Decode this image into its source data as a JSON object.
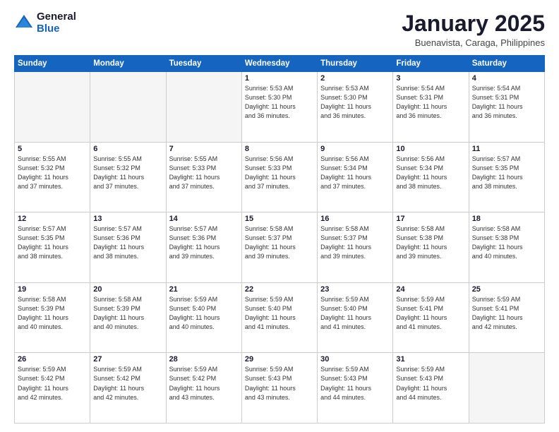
{
  "logo": {
    "general": "General",
    "blue": "Blue"
  },
  "header": {
    "month": "January 2025",
    "location": "Buenavista, Caraga, Philippines"
  },
  "weekdays": [
    "Sunday",
    "Monday",
    "Tuesday",
    "Wednesday",
    "Thursday",
    "Friday",
    "Saturday"
  ],
  "weeks": [
    [
      {
        "day": "",
        "info": ""
      },
      {
        "day": "",
        "info": ""
      },
      {
        "day": "",
        "info": ""
      },
      {
        "day": "1",
        "info": "Sunrise: 5:53 AM\nSunset: 5:30 PM\nDaylight: 11 hours\nand 36 minutes."
      },
      {
        "day": "2",
        "info": "Sunrise: 5:53 AM\nSunset: 5:30 PM\nDaylight: 11 hours\nand 36 minutes."
      },
      {
        "day": "3",
        "info": "Sunrise: 5:54 AM\nSunset: 5:31 PM\nDaylight: 11 hours\nand 36 minutes."
      },
      {
        "day": "4",
        "info": "Sunrise: 5:54 AM\nSunset: 5:31 PM\nDaylight: 11 hours\nand 36 minutes."
      }
    ],
    [
      {
        "day": "5",
        "info": "Sunrise: 5:55 AM\nSunset: 5:32 PM\nDaylight: 11 hours\nand 37 minutes."
      },
      {
        "day": "6",
        "info": "Sunrise: 5:55 AM\nSunset: 5:32 PM\nDaylight: 11 hours\nand 37 minutes."
      },
      {
        "day": "7",
        "info": "Sunrise: 5:55 AM\nSunset: 5:33 PM\nDaylight: 11 hours\nand 37 minutes."
      },
      {
        "day": "8",
        "info": "Sunrise: 5:56 AM\nSunset: 5:33 PM\nDaylight: 11 hours\nand 37 minutes."
      },
      {
        "day": "9",
        "info": "Sunrise: 5:56 AM\nSunset: 5:34 PM\nDaylight: 11 hours\nand 37 minutes."
      },
      {
        "day": "10",
        "info": "Sunrise: 5:56 AM\nSunset: 5:34 PM\nDaylight: 11 hours\nand 38 minutes."
      },
      {
        "day": "11",
        "info": "Sunrise: 5:57 AM\nSunset: 5:35 PM\nDaylight: 11 hours\nand 38 minutes."
      }
    ],
    [
      {
        "day": "12",
        "info": "Sunrise: 5:57 AM\nSunset: 5:35 PM\nDaylight: 11 hours\nand 38 minutes."
      },
      {
        "day": "13",
        "info": "Sunrise: 5:57 AM\nSunset: 5:36 PM\nDaylight: 11 hours\nand 38 minutes."
      },
      {
        "day": "14",
        "info": "Sunrise: 5:57 AM\nSunset: 5:36 PM\nDaylight: 11 hours\nand 39 minutes."
      },
      {
        "day": "15",
        "info": "Sunrise: 5:58 AM\nSunset: 5:37 PM\nDaylight: 11 hours\nand 39 minutes."
      },
      {
        "day": "16",
        "info": "Sunrise: 5:58 AM\nSunset: 5:37 PM\nDaylight: 11 hours\nand 39 minutes."
      },
      {
        "day": "17",
        "info": "Sunrise: 5:58 AM\nSunset: 5:38 PM\nDaylight: 11 hours\nand 39 minutes."
      },
      {
        "day": "18",
        "info": "Sunrise: 5:58 AM\nSunset: 5:38 PM\nDaylight: 11 hours\nand 40 minutes."
      }
    ],
    [
      {
        "day": "19",
        "info": "Sunrise: 5:58 AM\nSunset: 5:39 PM\nDaylight: 11 hours\nand 40 minutes."
      },
      {
        "day": "20",
        "info": "Sunrise: 5:58 AM\nSunset: 5:39 PM\nDaylight: 11 hours\nand 40 minutes."
      },
      {
        "day": "21",
        "info": "Sunrise: 5:59 AM\nSunset: 5:40 PM\nDaylight: 11 hours\nand 40 minutes."
      },
      {
        "day": "22",
        "info": "Sunrise: 5:59 AM\nSunset: 5:40 PM\nDaylight: 11 hours\nand 41 minutes."
      },
      {
        "day": "23",
        "info": "Sunrise: 5:59 AM\nSunset: 5:40 PM\nDaylight: 11 hours\nand 41 minutes."
      },
      {
        "day": "24",
        "info": "Sunrise: 5:59 AM\nSunset: 5:41 PM\nDaylight: 11 hours\nand 41 minutes."
      },
      {
        "day": "25",
        "info": "Sunrise: 5:59 AM\nSunset: 5:41 PM\nDaylight: 11 hours\nand 42 minutes."
      }
    ],
    [
      {
        "day": "26",
        "info": "Sunrise: 5:59 AM\nSunset: 5:42 PM\nDaylight: 11 hours\nand 42 minutes."
      },
      {
        "day": "27",
        "info": "Sunrise: 5:59 AM\nSunset: 5:42 PM\nDaylight: 11 hours\nand 42 minutes."
      },
      {
        "day": "28",
        "info": "Sunrise: 5:59 AM\nSunset: 5:42 PM\nDaylight: 11 hours\nand 43 minutes."
      },
      {
        "day": "29",
        "info": "Sunrise: 5:59 AM\nSunset: 5:43 PM\nDaylight: 11 hours\nand 43 minutes."
      },
      {
        "day": "30",
        "info": "Sunrise: 5:59 AM\nSunset: 5:43 PM\nDaylight: 11 hours\nand 44 minutes."
      },
      {
        "day": "31",
        "info": "Sunrise: 5:59 AM\nSunset: 5:43 PM\nDaylight: 11 hours\nand 44 minutes."
      },
      {
        "day": "",
        "info": ""
      }
    ]
  ]
}
